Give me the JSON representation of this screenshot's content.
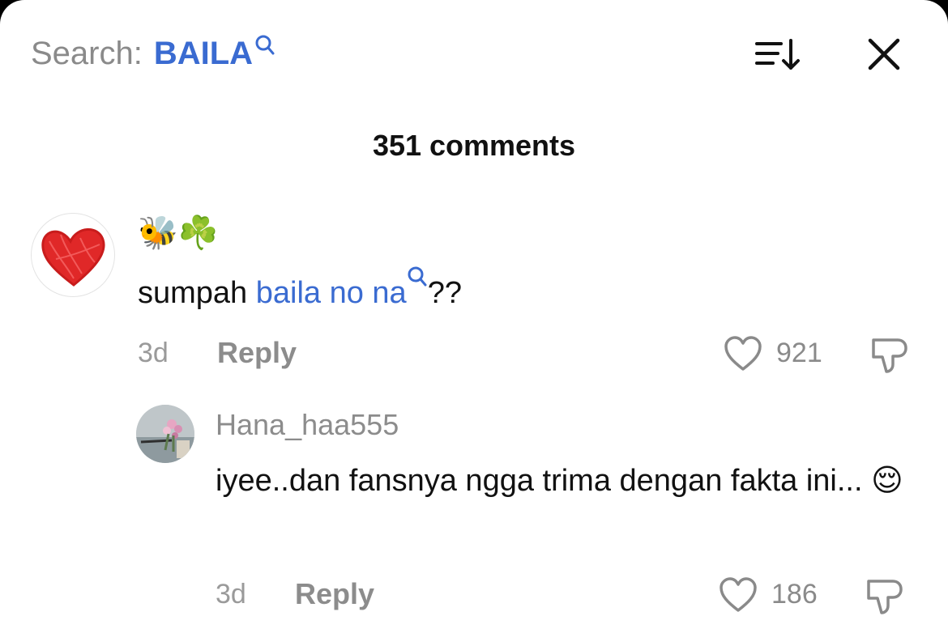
{
  "header": {
    "search_label": "Search:",
    "search_term": "BAILA",
    "sort_icon": "sort-descending-icon",
    "close_icon": "close-icon"
  },
  "comment_count": "351 comments",
  "comments": [
    {
      "username": "🐝☘️",
      "avatar": "red-heart-drawing",
      "text_plain": "sumpah ",
      "text_link": "baila no na",
      "text_suffix": "??",
      "time": "3d",
      "reply_label": "Reply",
      "likes": "921"
    }
  ],
  "replies": [
    {
      "username": "Hana_haa555",
      "avatar": "flowers-photo",
      "text": "iyee..dan fansnya ngga trima dengan fakta ini... 😌",
      "time": "3d",
      "reply_label": "Reply",
      "likes": "186"
    }
  ],
  "colors": {
    "link": "#3a6bd1",
    "muted": "#8a8a8a",
    "text": "#111111"
  }
}
